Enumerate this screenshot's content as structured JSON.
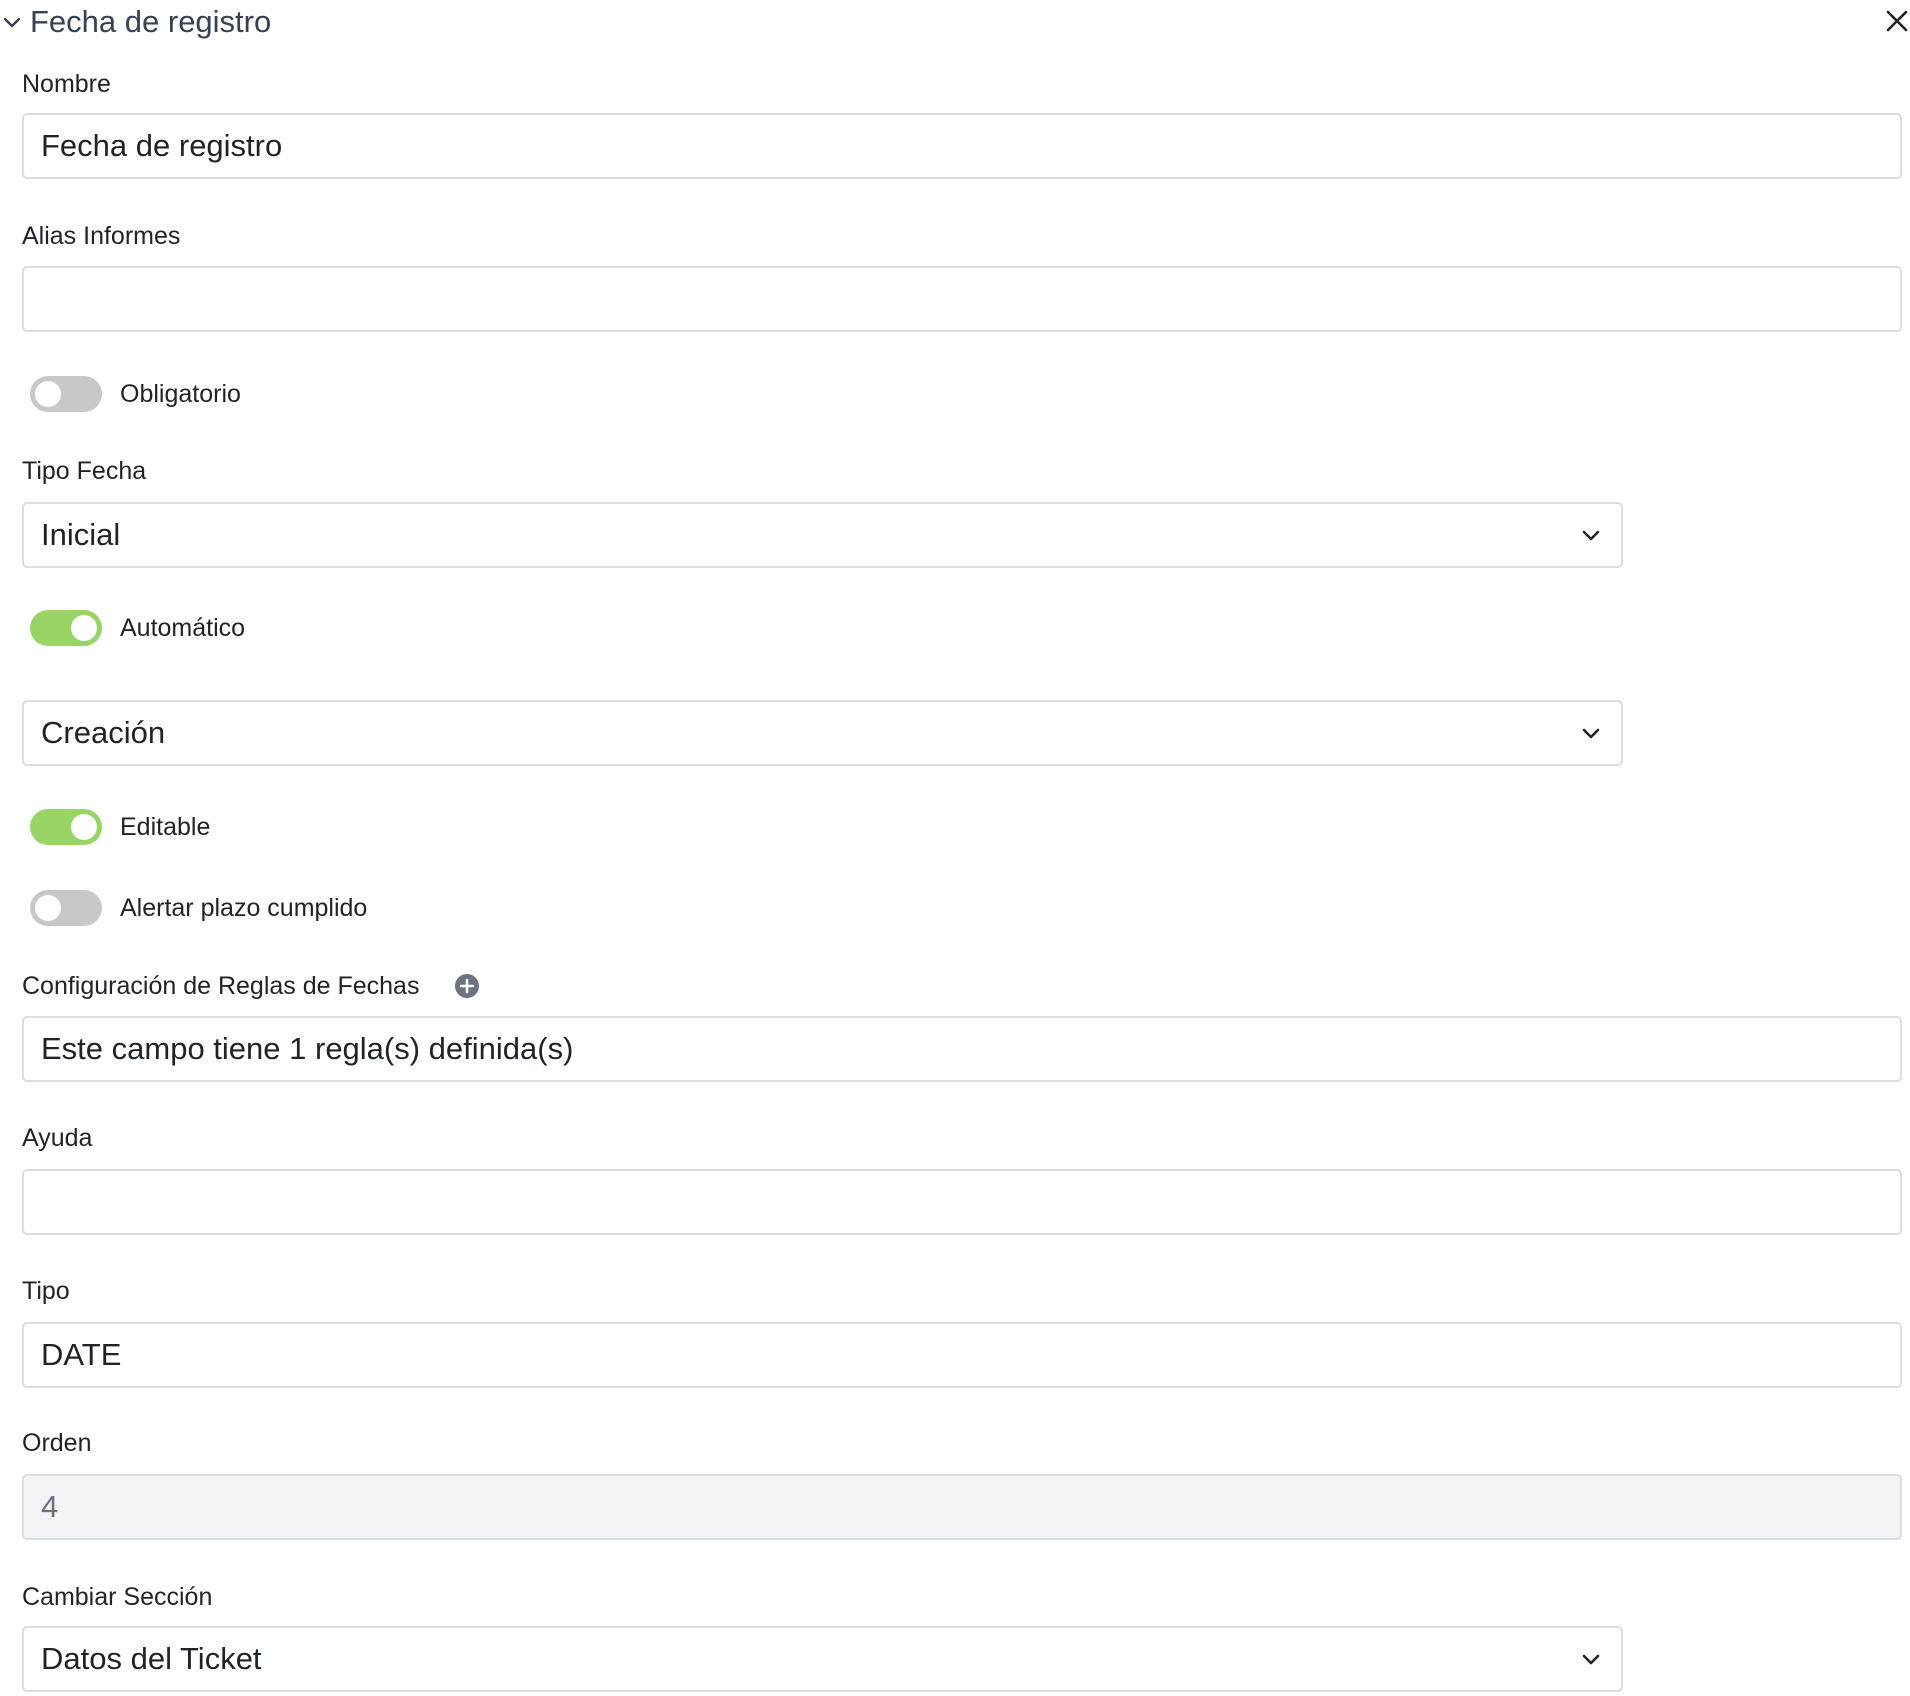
{
  "header": {
    "title": "Fecha de registro",
    "collapse_icon": "chevron-down-icon",
    "close_icon": "close-icon"
  },
  "fields": {
    "nombre": {
      "label": "Nombre",
      "value": "Fecha de registro"
    },
    "alias": {
      "label": "Alias Informes",
      "value": ""
    },
    "obligatorio": {
      "label": "Obligatorio",
      "checked": false
    },
    "tipo_fecha": {
      "label": "Tipo Fecha",
      "value": "Inicial"
    },
    "automatico": {
      "label": "Automático",
      "checked": true
    },
    "automatico_select": {
      "value": "Creación"
    },
    "editable": {
      "label": "Editable",
      "checked": true
    },
    "alertar": {
      "label": "Alertar plazo cumplido",
      "checked": false
    },
    "reglas": {
      "label": "Configuración de Reglas de Fechas",
      "add_icon": "plus-circle-icon",
      "value": "Este campo tiene 1 regla(s) definida(s)"
    },
    "ayuda": {
      "label": "Ayuda",
      "value": ""
    },
    "tipo": {
      "label": "Tipo",
      "value": "DATE"
    },
    "orden": {
      "label": "Orden",
      "value": "4"
    },
    "seccion": {
      "label": "Cambiar Sección",
      "value": "Datos del Ticket"
    }
  },
  "colors": {
    "toggle_on": "#9bd466",
    "toggle_off": "#c8c8c8",
    "border": "#dadde2",
    "disabled_bg": "#f3f4f5"
  }
}
